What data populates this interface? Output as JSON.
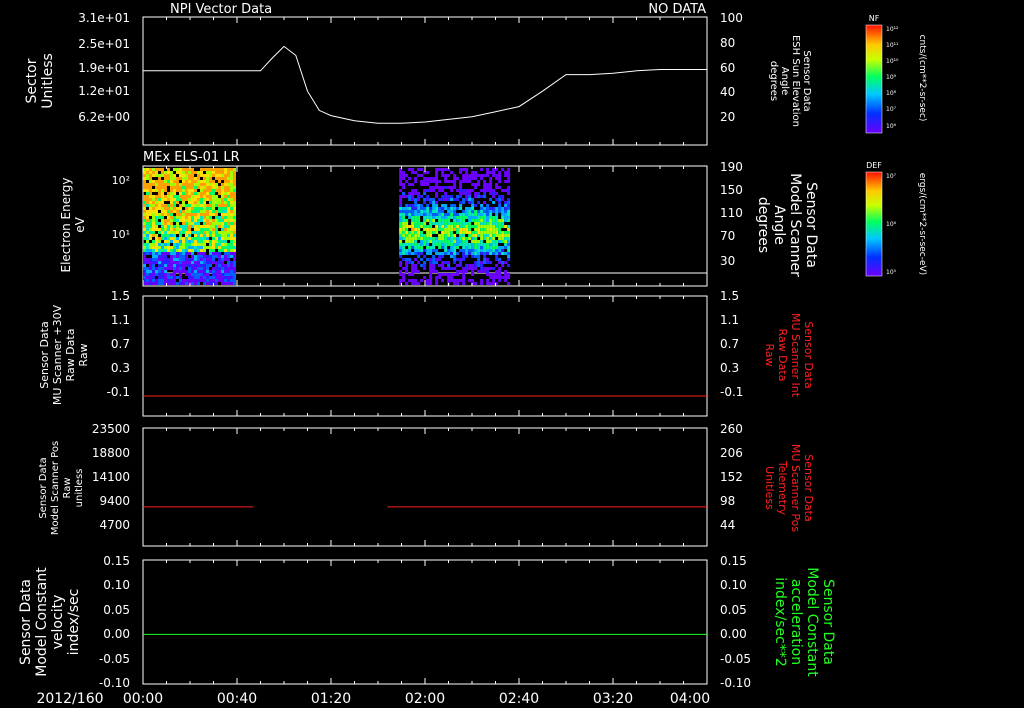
{
  "figure": {
    "date_label": "2012/160",
    "time_ticks": [
      "00:00",
      "00:40",
      "01:20",
      "02:00",
      "02:40",
      "03:20",
      "04:00"
    ]
  },
  "panels": [
    {
      "id": "npi",
      "title": "NPI Vector Data",
      "status": "NO DATA",
      "left_label": [
        "Sector",
        "Unitless"
      ],
      "left_ticks": [
        "3.1e+01",
        "2.5e+01",
        "1.9e+01",
        "1.2e+01",
        "6.2e+00"
      ],
      "right_label": [
        "Sensor Data",
        "ESH Sun Elevation",
        "Angle",
        "degrees"
      ],
      "right_ticks": [
        "100",
        "80",
        "60",
        "40",
        "20"
      ],
      "colorbar": {
        "label": "NF",
        "unit": "cnts/(cm**2-sr-sec)",
        "ticks": [
          "10¹²",
          "10¹¹",
          "10¹⁰",
          "10⁹",
          "10⁸",
          "10⁷",
          "10⁶"
        ]
      }
    },
    {
      "id": "els",
      "title": "MEx ELS-01 LR",
      "left_label": [
        "Electron Energy",
        "eV"
      ],
      "left_ticks": [
        "10²",
        "10¹"
      ],
      "right_label": [
        "Sensor Data",
        "Model Scanner",
        "Angle",
        "degrees"
      ],
      "right_ticks": [
        "190",
        "150",
        "110",
        "70",
        "30"
      ],
      "colorbar": {
        "label": "DEF",
        "unit": "ergs/(cm**2-sr-sec-eV)",
        "ticks": [
          "10⁷",
          "10⁶",
          "10⁵"
        ]
      }
    },
    {
      "id": "mu_raw",
      "left_label": [
        "Sensor Data",
        "MU Scanner +30V",
        "Raw Data",
        "Raw"
      ],
      "left_ticks": [
        "1.5",
        "1.1",
        "0.7",
        "0.3",
        "-0.1"
      ],
      "right_label": [
        "Sensor Data",
        "MU Scanner Int",
        "Raw Data",
        "Raw"
      ],
      "right_ticks": [
        "1.5",
        "1.1",
        "0.7",
        "0.3",
        "-0.1"
      ]
    },
    {
      "id": "scanner_pos",
      "left_label": [
        "Sensor Data",
        "Model Scanner Pos",
        "Raw",
        "unitless"
      ],
      "left_ticks": [
        "23500",
        "18800",
        "14100",
        "9400",
        "4700"
      ],
      "right_label": [
        "Sensor Data",
        "MU Scanner Pos",
        "Telemetry",
        "Unitless"
      ],
      "right_ticks": [
        "260",
        "206",
        "152",
        "98",
        "44"
      ]
    },
    {
      "id": "constant",
      "left_label": [
        "Sensor Data",
        "Model Constant",
        "velocity",
        "index/sec"
      ],
      "left_ticks": [
        "0.15",
        "0.10",
        "0.05",
        "0.00",
        "-0.05",
        "-0.10"
      ],
      "right_label": [
        "Sensor Data",
        "Model Constant",
        "acceleration",
        "index/sec**2"
      ],
      "right_ticks": [
        "0.15",
        "0.10",
        "0.05",
        "0.00",
        "-0.05",
        "-0.10"
      ]
    }
  ],
  "chart_data": [
    {
      "type": "line",
      "panel": "npi",
      "axis": "right",
      "x_unit": "minutes",
      "x": [
        0,
        20,
        40,
        50,
        55,
        60,
        65,
        70,
        75,
        80,
        90,
        100,
        110,
        120,
        130,
        140,
        150,
        160,
        170,
        180,
        190,
        200,
        210,
        220,
        230,
        240
      ],
      "y": [
        58,
        58,
        58,
        58,
        68,
        77,
        70,
        42,
        27,
        23,
        19,
        17,
        17,
        18,
        20,
        22,
        26,
        30,
        42,
        55,
        55,
        56,
        58,
        59,
        59,
        59
      ],
      "ylim": [
        0,
        100
      ]
    },
    {
      "type": "heatmap",
      "panel": "els",
      "data_intervals_minutes": [
        [
          0,
          39
        ],
        [
          109,
          155
        ]
      ],
      "y_label": "Electron Energy eV",
      "ylog": true
    },
    {
      "type": "line",
      "panel": "mu_raw",
      "color": "#ff2020",
      "x": [
        0,
        240
      ],
      "y": [
        0.0,
        0.0
      ],
      "ylim": [
        -0.3,
        1.5
      ]
    },
    {
      "type": "line",
      "panel": "scanner_pos",
      "color": "#ff2020",
      "segments": [
        {
          "x": [
            0,
            47
          ],
          "y": [
            7800,
            7800
          ]
        },
        {
          "x": [
            104,
            240
          ],
          "y": [
            7800,
            7800
          ]
        }
      ],
      "ylim": [
        0,
        23500
      ]
    },
    {
      "type": "line",
      "panel": "constant",
      "color": "#20ff20",
      "x": [
        0,
        240
      ],
      "y": [
        0.0,
        0.0
      ],
      "ylim": [
        -0.1,
        0.15
      ]
    }
  ]
}
